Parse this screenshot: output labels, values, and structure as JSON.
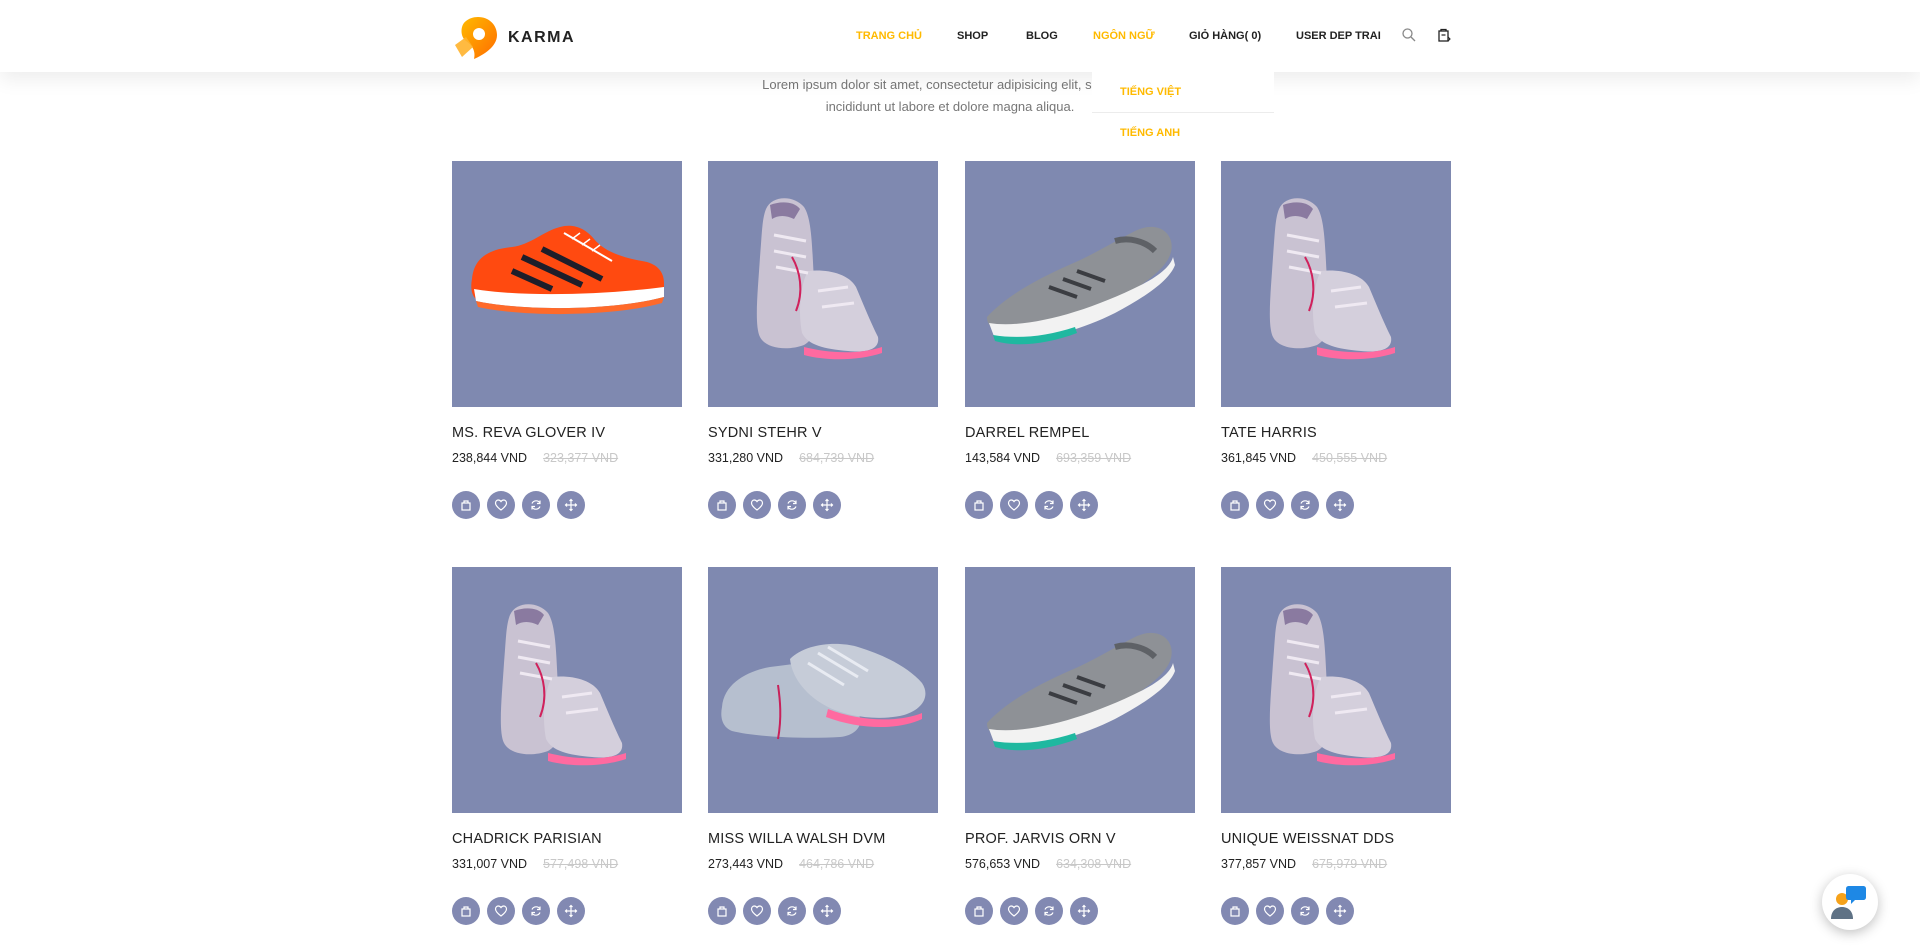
{
  "header": {
    "logo_text": "KARMA",
    "nav": [
      {
        "label": "TRANG CHỦ",
        "active": true
      },
      {
        "label": "SHOP",
        "active": false
      },
      {
        "label": "BLOG",
        "active": false
      },
      {
        "label": "NGÔN NGỮ",
        "active": true
      },
      {
        "label": "GIỎ HÀNG( 0)",
        "active": false
      },
      {
        "label": "USER DEP TRAI",
        "active": false
      }
    ],
    "icons": [
      "search-icon",
      "cart-icon"
    ]
  },
  "language_dropdown": {
    "items": [
      "TIẾNG VIỆT",
      "TIẾNG ANH"
    ]
  },
  "intro_text_line1": "Lorem ipsum dolor sit amet, consectetur adipisicing elit, sed do ei",
  "intro_text_line2": "incididunt ut labore et dolore magna aliqua.",
  "products": [
    {
      "name": "MS. REVA GLOVER IV",
      "price": "238,844 VND",
      "old_price": "323,377 VND",
      "image": "orange-running-shoe"
    },
    {
      "name": "SYDNI STEHR V",
      "price": "331,280 VND",
      "old_price": "684,739 VND",
      "image": "grey-sneakers-pair"
    },
    {
      "name": "DARREL REMPEL",
      "price": "143,584 VND",
      "old_price": "693,359 VND",
      "image": "grey-knit-runner"
    },
    {
      "name": "TATE HARRIS",
      "price": "361,845 VND",
      "old_price": "450,555 VND",
      "image": "grey-sneakers-pair"
    },
    {
      "name": "CHADRICK PARISIAN",
      "price": "331,007 VND",
      "old_price": "577,498 VND",
      "image": "grey-sneakers-pair"
    },
    {
      "name": "MISS WILLA WALSH DVM",
      "price": "273,443 VND",
      "old_price": "464,786 VND",
      "image": "grey-sneakers-side"
    },
    {
      "name": "PROF. JARVIS ORN V",
      "price": "576,653 VND",
      "old_price": "634,308 VND",
      "image": "grey-knit-runner"
    },
    {
      "name": "UNIQUE WEISSNAT DDS",
      "price": "377,857 VND",
      "old_price": "675,979 VND",
      "image": "grey-sneakers-pair"
    }
  ],
  "card_actions": [
    "add-to-bag-icon",
    "wishlist-heart-icon",
    "compare-sync-icon",
    "view-more-arrows-icon"
  ],
  "colors": {
    "accent": "#ffba00",
    "card_bg": "#7f89b0",
    "action_bg": "#8289b2"
  }
}
